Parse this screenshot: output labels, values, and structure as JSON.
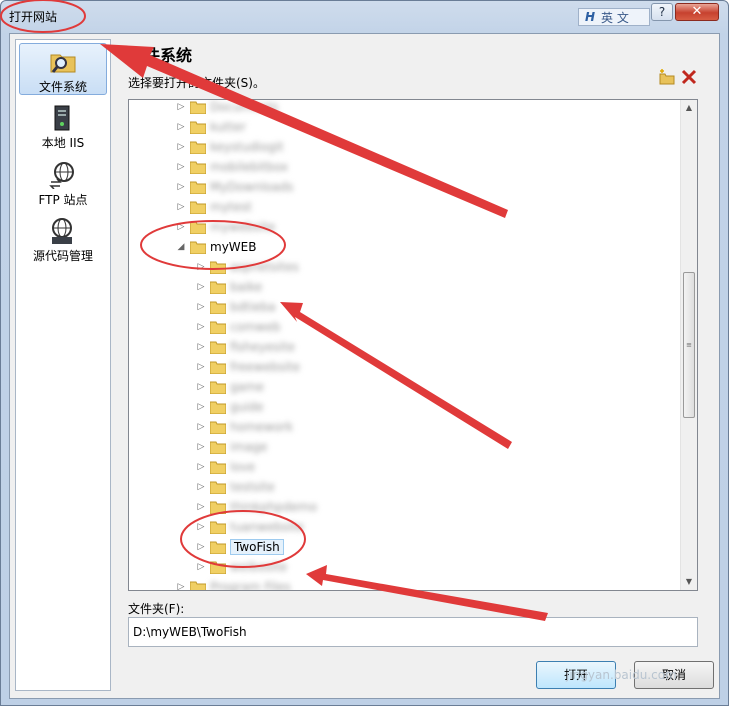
{
  "window": {
    "title": "打开网站"
  },
  "ime": {
    "logo": "ᕼ",
    "lang_label": "英 文"
  },
  "titlebar": {
    "help_label": "?",
    "close_label": "✕"
  },
  "nav": {
    "items": [
      {
        "label": "文件系统",
        "icon": "folder-search-icon",
        "selected": true
      },
      {
        "label": "本地 IIS",
        "icon": "server-icon",
        "selected": false
      },
      {
        "label": "FTP 站点",
        "icon": "globe-transfer-icon",
        "selected": false
      },
      {
        "label": "源代码管理",
        "icon": "source-control-icon",
        "selected": false
      }
    ]
  },
  "panel": {
    "title": "文件系统",
    "select_label": "选择要打开的文件夹(S)。",
    "toolbar": {
      "new_folder_icon": "new-folder-icon",
      "delete_icon": "delete-icon"
    }
  },
  "tree": {
    "items": [
      {
        "label": "Documents",
        "blurred": true,
        "expanded": false
      },
      {
        "label": "kutter",
        "blurred": true,
        "expanded": false
      },
      {
        "label": "keystudiogit",
        "blurred": true,
        "expanded": false
      },
      {
        "label": "mobilebitbox",
        "blurred": true,
        "expanded": false
      },
      {
        "label": "MyDownloads",
        "blurred": true,
        "expanded": false
      },
      {
        "label": "mytest",
        "blurred": true,
        "expanded": false
      },
      {
        "label": "mywebsite",
        "blurred": true,
        "expanded": false
      },
      {
        "label": "myWEB",
        "blurred": false,
        "expanded": true
      },
      {
        "label": "aspnetsites",
        "blurred": true,
        "expanded": false
      },
      {
        "label": "baike",
        "blurred": true,
        "expanded": false
      },
      {
        "label": "bdtieba",
        "blurred": true,
        "expanded": false
      },
      {
        "label": "comweb",
        "blurred": true,
        "expanded": false
      },
      {
        "label": "fisheyesite",
        "blurred": true,
        "expanded": false
      },
      {
        "label": "freewebsite",
        "blurred": true,
        "expanded": false
      },
      {
        "label": "game",
        "blurred": true,
        "expanded": false
      },
      {
        "label": "guide",
        "blurred": true,
        "expanded": false
      },
      {
        "label": "homework",
        "blurred": true,
        "expanded": false
      },
      {
        "label": "image",
        "blurred": true,
        "expanded": false
      },
      {
        "label": "love",
        "blurred": true,
        "expanded": false
      },
      {
        "label": "testsite",
        "blurred": true,
        "expanded": false
      },
      {
        "label": "thinkphpdemo",
        "blurred": true,
        "expanded": false
      },
      {
        "label": "tuanwebsite",
        "blurred": true,
        "expanded": false
      },
      {
        "label": "TwoFish",
        "blurred": false,
        "expanded": false,
        "selected": true
      },
      {
        "label": "weibosite",
        "blurred": true,
        "expanded": false
      },
      {
        "label": "Program Files",
        "blurred": true,
        "expanded": false
      }
    ]
  },
  "folder_field": {
    "label": "文件夹(F):",
    "value": "D:\\myWEB\\TwoFish"
  },
  "buttons": {
    "open": "打开",
    "cancel": "取消"
  },
  "watermark": "jingyan.baidu.com",
  "colors": {
    "annotation": "#e03a3a",
    "selection": "#e5f1fb"
  }
}
